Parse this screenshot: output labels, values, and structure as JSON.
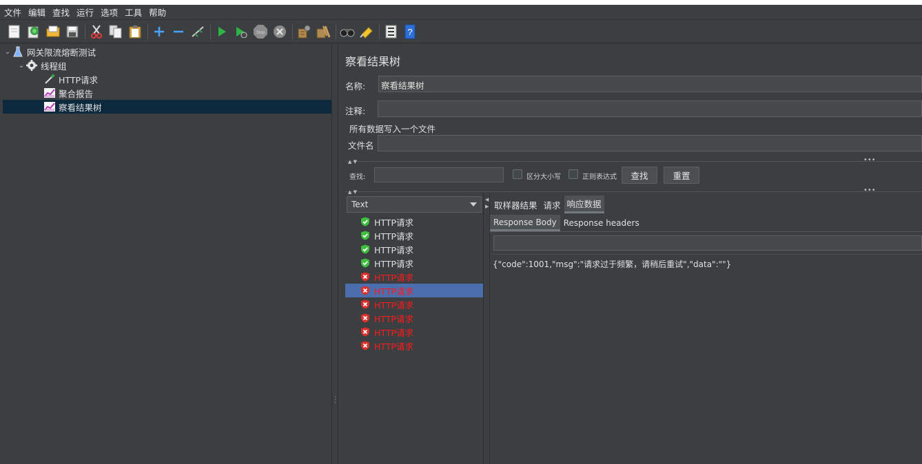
{
  "menu": [
    "文件",
    "编辑",
    "查找",
    "运行",
    "选项",
    "工具",
    "帮助"
  ],
  "toolbar": {
    "icons": [
      "new-file-icon",
      "templates-icon",
      "open-icon",
      "save-icon",
      "cut-icon",
      "copy-icon",
      "paste-icon",
      "expand-icon",
      "collapse-icon",
      "toggle-icon",
      "start-icon",
      "start-no-pause-icon",
      "stop-icon",
      "shutdown-icon",
      "clear-icon",
      "clear-all-icon",
      "search-icon",
      "reset-search-icon",
      "function-helper-icon",
      "help-icon"
    ],
    "stop_label": "Stop"
  },
  "tree": {
    "items": [
      {
        "label": "网关限流熔断测试",
        "level": 0,
        "icon": "test-plan-icon",
        "expanded": true
      },
      {
        "label": "线程组",
        "level": 1,
        "icon": "gear-icon",
        "expanded": true
      },
      {
        "label": "HTTP请求",
        "level": 2,
        "icon": "pipette-icon"
      },
      {
        "label": "聚合报告",
        "level": 2,
        "icon": "graph-icon"
      },
      {
        "label": "察看结果树",
        "level": 2,
        "icon": "graph-icon",
        "selected": true
      }
    ]
  },
  "panel": {
    "title": "察看结果树",
    "name_label": "名称:",
    "name_value": "察看结果树",
    "comment_label": "注释:",
    "comment_value": "",
    "file_section_label": "所有数据写入一个文件",
    "filename_label": "文件名",
    "filename_value": ""
  },
  "search": {
    "label": "查找:",
    "value": "",
    "case_sensitive_label": "区分大小写",
    "regex_label": "正则表达式",
    "find_button": "查找",
    "reset_button": "重置"
  },
  "renderer": {
    "selected": "Text"
  },
  "results": [
    {
      "label": "HTTP请求",
      "status": "ok"
    },
    {
      "label": "HTTP请求",
      "status": "ok"
    },
    {
      "label": "HTTP请求",
      "status": "ok"
    },
    {
      "label": "HTTP请求",
      "status": "ok"
    },
    {
      "label": "HTTP请求",
      "status": "error"
    },
    {
      "label": "HTTP请求",
      "status": "error",
      "selected": true
    },
    {
      "label": "HTTP请求",
      "status": "error"
    },
    {
      "label": "HTTP请求",
      "status": "error"
    },
    {
      "label": "HTTP请求",
      "status": "error"
    },
    {
      "label": "HTTP请求",
      "status": "error"
    }
  ],
  "result_tabs": {
    "items": [
      "取样器结果",
      "请求",
      "响应数据"
    ],
    "active": 2
  },
  "response_tabs": {
    "items": [
      "Response Body",
      "Response headers"
    ],
    "active": 0
  },
  "response": {
    "search_value": "",
    "body": "{\"code\":1001,\"msg\":\"请求过于频繁，请稍后重试\",\"data\":\"\"}"
  },
  "colors": {
    "background": "#3c3f41",
    "selection_tree": "#0d293e",
    "selection_list": "#4b6eaf",
    "error_text": "#ff1a1a",
    "ok_icon": "#3fbf3f",
    "error_icon": "#d9322c"
  }
}
